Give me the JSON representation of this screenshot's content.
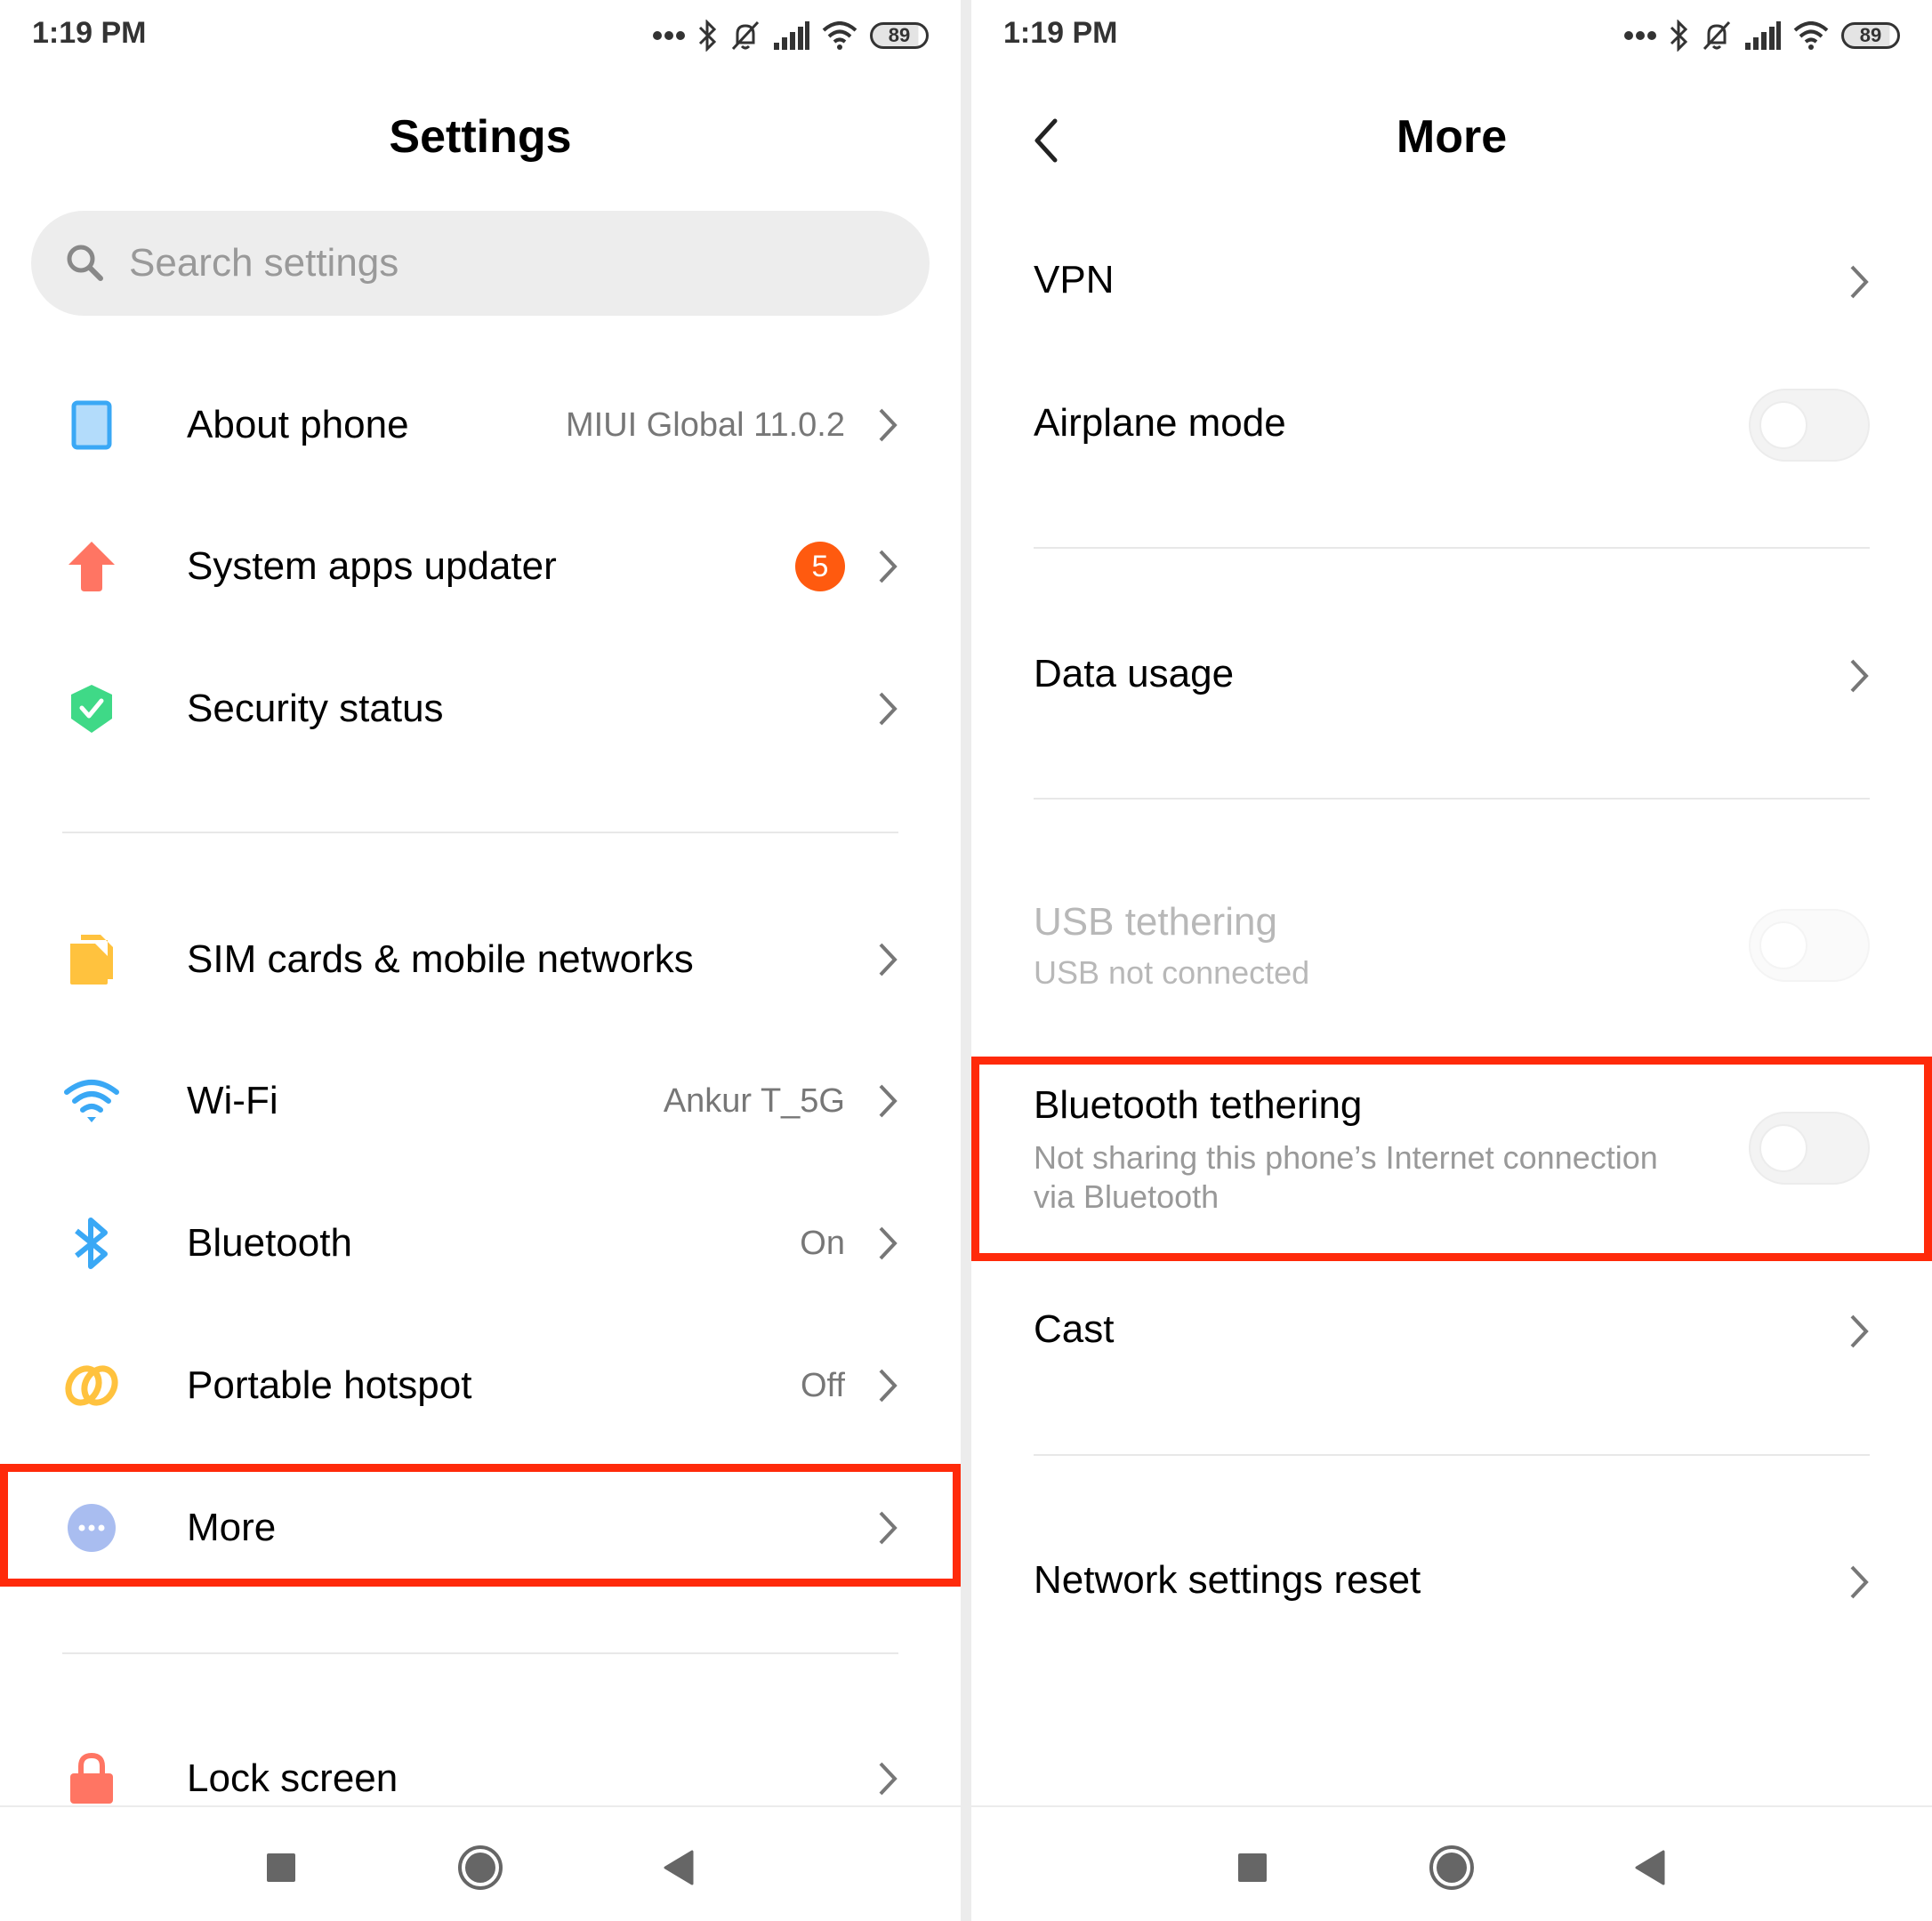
{
  "status_bar": {
    "time": "1:19 PM",
    "battery": "89"
  },
  "left": {
    "title": "Settings",
    "search": {
      "placeholder": "Search settings"
    },
    "items": [
      {
        "id": "about-phone",
        "label": "About phone",
        "value": "MIUI Global 11.0.2",
        "icon": "phone-icon"
      },
      {
        "id": "system-apps-updater",
        "label": "System apps updater",
        "badge": "5",
        "icon": "arrow-up-icon"
      },
      {
        "id": "security-status",
        "label": "Security status",
        "icon": "shield-check-icon"
      },
      {
        "id": "sim-cards",
        "label": "SIM cards & mobile networks",
        "icon": "sim-card-icon"
      },
      {
        "id": "wifi",
        "label": "Wi-Fi",
        "value": "Ankur T_5G",
        "icon": "wifi-icon"
      },
      {
        "id": "bluetooth",
        "label": "Bluetooth",
        "value": "On",
        "icon": "bluetooth-icon"
      },
      {
        "id": "portable-hotspot",
        "label": "Portable hotspot",
        "value": "Off",
        "icon": "hotspot-icon"
      },
      {
        "id": "more",
        "label": "More",
        "icon": "more-dots-icon",
        "highlighted": true
      },
      {
        "id": "lock-screen",
        "label": "Lock screen",
        "icon": "lock-icon"
      }
    ]
  },
  "right": {
    "title": "More",
    "items": [
      {
        "id": "vpn",
        "label": "VPN",
        "type": "link"
      },
      {
        "id": "airplane-mode",
        "label": "Airplane mode",
        "type": "toggle",
        "on": false
      },
      {
        "id": "data-usage",
        "label": "Data usage",
        "type": "link"
      },
      {
        "id": "usb-tethering",
        "label": "USB tethering",
        "sub": "USB not connected",
        "type": "toggle",
        "on": false,
        "disabled": true
      },
      {
        "id": "bluetooth-tethering",
        "label": "Bluetooth tethering",
        "sub": "Not sharing this phone’s Internet connection",
        "sub2": "via Bluetooth",
        "type": "toggle",
        "on": false,
        "highlighted": true
      },
      {
        "id": "cast",
        "label": "Cast",
        "type": "link"
      },
      {
        "id": "network-settings-reset",
        "label": "Network settings reset",
        "type": "link"
      }
    ]
  },
  "colors": {
    "highlight": "#ff2a0a",
    "badge": "#ff5a0f",
    "accent_blue": "#3aa8f5"
  }
}
